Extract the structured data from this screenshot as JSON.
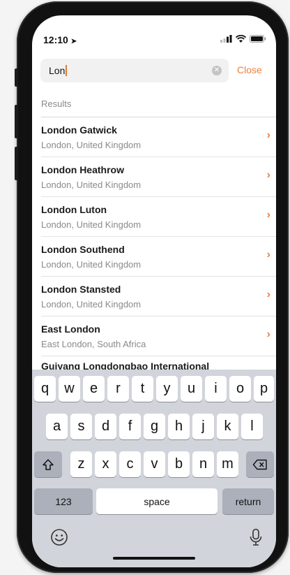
{
  "status": {
    "time": "12:10"
  },
  "search": {
    "query": "Lon",
    "close_label": "Close"
  },
  "results_label": "Results",
  "results": [
    {
      "name": "London Gatwick",
      "location": "London, United Kingdom"
    },
    {
      "name": "London Heathrow",
      "location": "London, United Kingdom"
    },
    {
      "name": "London Luton",
      "location": "London, United Kingdom"
    },
    {
      "name": "London Southend",
      "location": "London, United Kingdom"
    },
    {
      "name": "London Stansted",
      "location": "London, United Kingdom"
    },
    {
      "name": "East London",
      "location": "East London, South Africa"
    }
  ],
  "partial_result": "Guiyang Longdongbao International",
  "keyboard": {
    "row1": [
      "q",
      "w",
      "e",
      "r",
      "t",
      "y",
      "u",
      "i",
      "o",
      "p"
    ],
    "row2": [
      "a",
      "s",
      "d",
      "f",
      "g",
      "h",
      "j",
      "k",
      "l"
    ],
    "row3": [
      "z",
      "x",
      "c",
      "v",
      "b",
      "n",
      "m"
    ],
    "numbers_label": "123",
    "space_label": "space",
    "return_label": "return"
  },
  "colors": {
    "accent": "#ee7f3d"
  }
}
